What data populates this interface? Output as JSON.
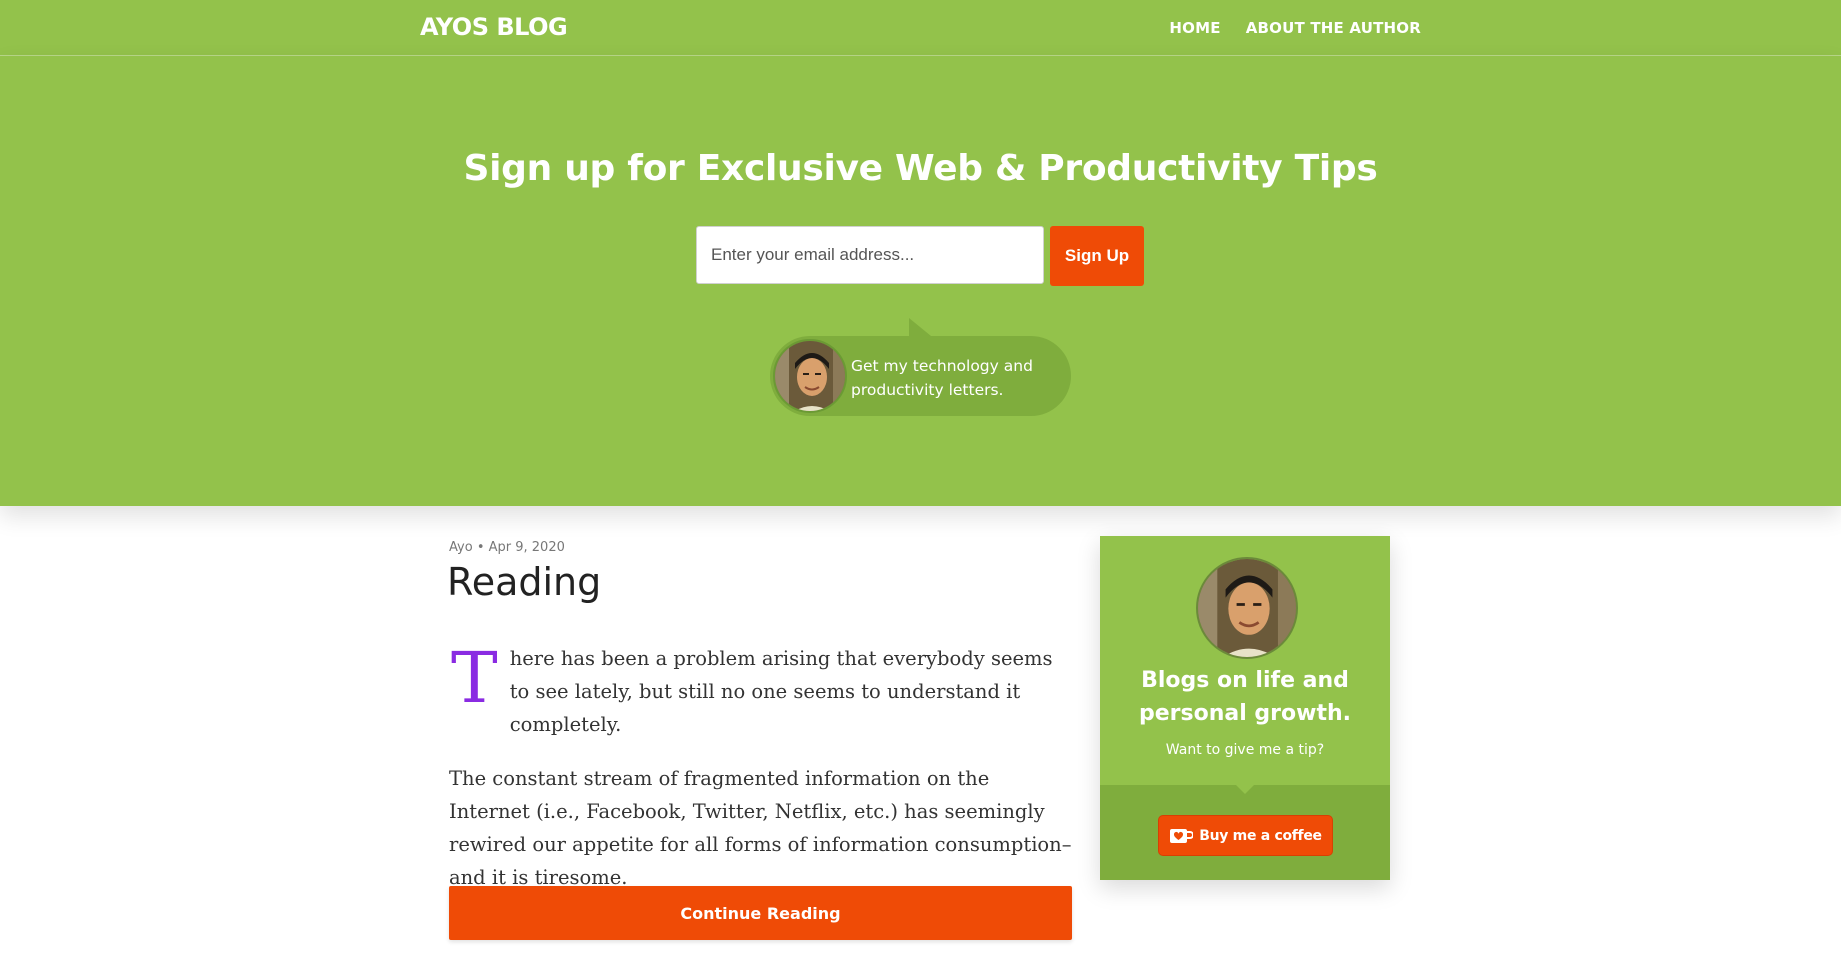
{
  "nav": {
    "brand": "AYOS BLOG",
    "links": [
      "HOME",
      "ABOUT THE AUTHOR"
    ]
  },
  "hero": {
    "title": "Sign up for Exclusive Web & Productivity Tips",
    "email_placeholder": "Enter your email address...",
    "signup_label": "Sign Up",
    "bubble_text": "Get my technology and productivity letters."
  },
  "post": {
    "author": "Ayo",
    "date": "Apr 9, 2020",
    "meta_separator": "•",
    "title": "Reading",
    "drop_cap": "T",
    "first_paragraph_rest": "here has been a problem arising that everybody seems to see lately, but still no one seems to understand it completely.",
    "second_paragraph": "The constant stream of fragmented information on the Internet (i.e., Facebook, Twitter, Netflix, etc.) has seemingly rewired our appetite for all forms of information consumption–and it is tiresome.",
    "continue_label": "Continue Reading"
  },
  "sidebar": {
    "title": "Blogs on life and personal growth.",
    "subtitle": "Want to give me a tip?",
    "coffee_label": "Buy me a coffee"
  },
  "colors": {
    "green": "#93c24b",
    "dark_green": "#7fad3d",
    "orange": "#ef4b06",
    "drop_cap": "#8a2be2"
  },
  "icons": [
    "avatar-photo",
    "coffee-cup-icon"
  ]
}
